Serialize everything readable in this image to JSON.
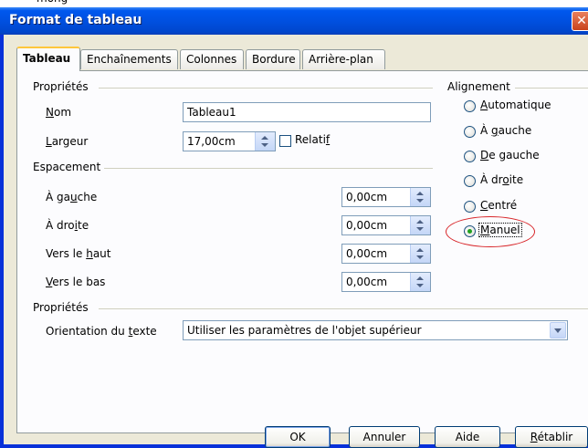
{
  "top_fragment": "mong",
  "window": {
    "title": "Format de tableau",
    "close_glyph": "✕"
  },
  "tabs": [
    {
      "label": "Tableau",
      "active": true
    },
    {
      "label": "Enchaînements"
    },
    {
      "label": "Colonnes"
    },
    {
      "label": "Bordure"
    },
    {
      "label": "Arrière-plan"
    }
  ],
  "properties": {
    "header": "Propriétés",
    "name": {
      "label": "Nom",
      "value": "Tableau1"
    },
    "width": {
      "label": "Largeur",
      "value": "17,00cm"
    },
    "relative": {
      "label": "Relatif",
      "checked": false
    }
  },
  "spacing": {
    "header": "Espacement",
    "rows": [
      {
        "label": "À gauche",
        "value": "0,00cm"
      },
      {
        "label": "À droite",
        "value": "0,00cm"
      },
      {
        "label": "Vers le haut",
        "value": "0,00cm"
      },
      {
        "label": "Vers le bas",
        "value": "0,00cm"
      }
    ]
  },
  "alignment": {
    "header": "Alignement",
    "options": [
      {
        "label": "Automatique",
        "selected": false
      },
      {
        "label": "À gauche",
        "selected": false
      },
      {
        "label": "De gauche",
        "selected": false
      },
      {
        "label": "À droite",
        "selected": false
      },
      {
        "label": "Centré",
        "selected": false
      },
      {
        "label": "Manuel",
        "selected": true
      }
    ],
    "annotation_color": "#d8262a"
  },
  "properties2": {
    "header": "Propriétés",
    "orientation": {
      "label": "Orientation du texte",
      "value": "Utiliser les paramètres de l'objet supérieur"
    }
  },
  "buttons": {
    "ok": "OK",
    "cancel": "Annuler",
    "help": "Aide",
    "reset": "Rétablir"
  },
  "colors": {
    "titlebar": "#0054e3",
    "dialog_bg": "#ece9d8",
    "panel_bg": "#fcfcfe"
  }
}
